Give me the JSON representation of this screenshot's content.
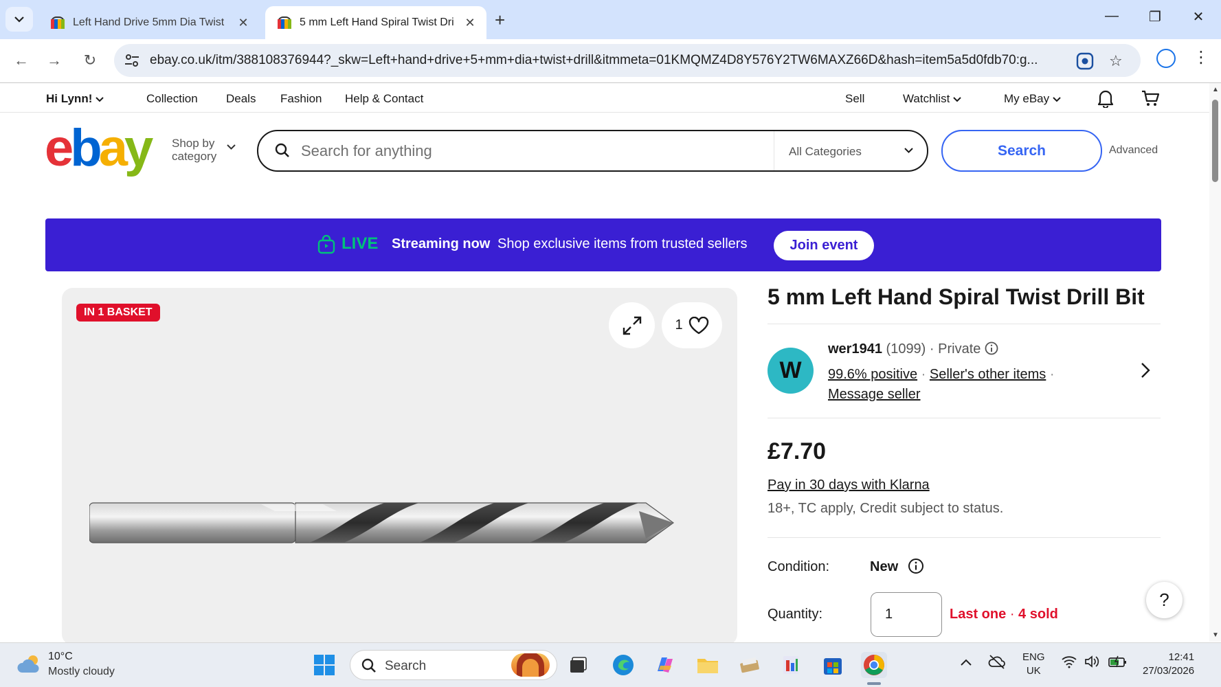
{
  "browser": {
    "tabs": [
      {
        "title": "Left Hand Drive 5mm Dia Twist",
        "active": false
      },
      {
        "title": "5 mm Left Hand Spiral Twist Dri",
        "active": true
      }
    ],
    "new_tab_label": "+",
    "url": "ebay.co.uk/itm/388108376944?_skw=Left+hand+drive+5+mm+dia+twist+drill&itmmeta=01KMQMZ4D8Y576Y2TW6MAXZ66D&hash=item5a5d0fdb70:g..."
  },
  "ebay": {
    "utility_nav": {
      "greeting": "Hi Lynn!",
      "links": [
        "Collection",
        "Deals",
        "Fashion",
        "Help & Contact"
      ],
      "sell": "Sell",
      "watchlist": "Watchlist",
      "my_ebay": "My eBay"
    },
    "header": {
      "logo": {
        "e": "e",
        "b": "b",
        "a": "a",
        "y": "y"
      },
      "shop_by_line1": "Shop by",
      "shop_by_line2": "category",
      "search_placeholder": "Search for anything",
      "category": "All Categories",
      "search_button": "Search",
      "advanced": "Advanced"
    },
    "live_banner": {
      "live": "LIVE",
      "streaming_now": "Streaming now",
      "description": "Shop exclusive items from trusted sellers",
      "button": "Join event"
    },
    "gallery": {
      "badge": "IN 1 BASKET",
      "watch_count": "1"
    },
    "product": {
      "title": "5 mm Left Hand Spiral Twist Drill Bit",
      "seller": {
        "initial": "W",
        "name": "wer1941",
        "feedback_count": "(1099)",
        "type_separator": "·",
        "type": "Private",
        "positive": "99.6% positive",
        "other_items": "Seller's other items",
        "message": "Message seller"
      },
      "price": "£7.70",
      "klarna": "Pay in 30 days with Klarna",
      "klarna_note": "18+, TC apply, Credit subject to status.",
      "condition_label": "Condition:",
      "condition_value": "New",
      "quantity_label": "Quantity:",
      "quantity_value": "1",
      "availability": "Last one",
      "sold": "4 sold",
      "help": "?"
    }
  },
  "taskbar": {
    "weather_temp": "10°C",
    "weather_desc": "Mostly cloudy",
    "search": "Search",
    "lang_line1": "ENG",
    "lang_line2": "UK",
    "time": "12:41",
    "date": "27/03/2026"
  },
  "colors": {
    "ebay_blue": "#3665f3",
    "live_banner": "#3a1fd3",
    "live_green": "#00c27a",
    "alert_red": "#e0102b",
    "avatar_teal": "#2db8c4"
  }
}
